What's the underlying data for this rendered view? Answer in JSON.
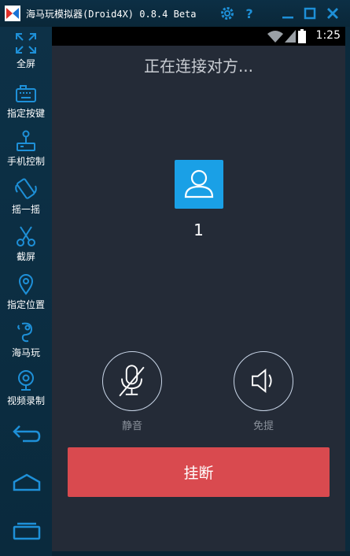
{
  "window": {
    "title": "海马玩模拟器(Droid4X) 0.8.4 Beta"
  },
  "titlebar": {
    "buttons": [
      {
        "name": "settings-button",
        "icon": "gear-icon"
      },
      {
        "name": "help-button",
        "icon": "question-icon"
      },
      {
        "name": "minimize-button",
        "icon": "minimize-icon"
      },
      {
        "name": "maximize-button",
        "icon": "maximize-icon"
      },
      {
        "name": "close-button",
        "icon": "close-icon"
      }
    ]
  },
  "sidebar": {
    "items": [
      {
        "label": "全屏",
        "icon": "fullscreen-icon"
      },
      {
        "label": "指定按键",
        "icon": "keyboard-icon"
      },
      {
        "label": "手机控制",
        "icon": "joystick-icon"
      },
      {
        "label": "摇一摇",
        "icon": "shake-phone-icon"
      },
      {
        "label": "截屏",
        "icon": "scissors-icon"
      },
      {
        "label": "指定位置",
        "icon": "location-pin-icon"
      },
      {
        "label": "海马玩",
        "icon": "seahorse-icon"
      },
      {
        "label": "视频录制",
        "icon": "webcam-icon"
      }
    ],
    "nav": [
      {
        "icon": "back-arrow-icon"
      },
      {
        "icon": "home-icon"
      },
      {
        "icon": "recent-apps-icon"
      }
    ]
  },
  "statusbar": {
    "time": "1:25",
    "icons": [
      "wifi-icon",
      "signal-icon",
      "battery-icon"
    ]
  },
  "call": {
    "status": "正在连接对方...",
    "caller_name": "1",
    "mute_label": "静音",
    "speaker_label": "免提",
    "hangup_label": "挂断"
  },
  "colors": {
    "screen_bg": "#242b37",
    "accent_blue": "#1aa0e6",
    "hangup_red": "#d94a4f",
    "sidebar_bg": "#0d3147"
  }
}
